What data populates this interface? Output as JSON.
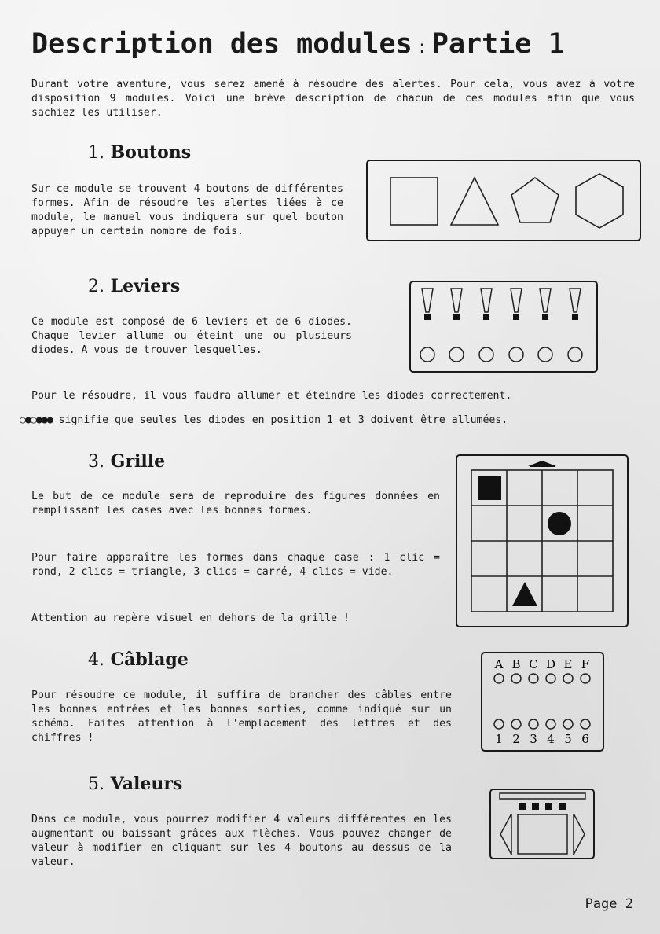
{
  "title": {
    "main": "Description des modules",
    "separator": ":",
    "part_word": "Partie",
    "part_number": "1"
  },
  "intro": "Durant votre aventure, vous serez amené à résoudre des alertes. Pour cela, vous avez à votre disposition 9 modules. Voici une brève description de chacun de ces modules afin que vous sachiez les utiliser.",
  "sections": {
    "boutons": {
      "number": "1.",
      "title": "Boutons",
      "text": "Sur ce module se trouvent 4 boutons de différentes formes. Afin de résoudre les alertes liées à ce module, le manuel vous indiquera sur quel bouton appuyer un certain nombre de fois."
    },
    "leviers": {
      "number": "2.",
      "title": "Leviers",
      "text": "Ce module est composé de 6 leviers et de 6 diodes. Chaque levier allume ou éteint une ou plusieurs diodes. A vous de trouver lesquelles.",
      "note": "Pour le résoudre, il vous faudra allumer et éteindre les diodes correctement.",
      "example_symbols": "○●○●●●",
      "example_text": "signifie que seules les diodes en position 1 et 3 doivent être allumées."
    },
    "grille": {
      "number": "3.",
      "title": "Grille",
      "text1": "Le but de ce module sera de reproduire des figures données en remplissant les cases avec les bonnes formes.",
      "text2": "Pour faire apparaître les formes dans chaque case : 1 clic = rond, 2 clics = triangle, 3 clics = carré, 4 clics = vide.",
      "text3": "Attention au repère visuel en dehors de la grille !"
    },
    "cablage": {
      "number": "4.",
      "title": "Câblage",
      "text": "Pour résoudre ce module, il suffira de brancher des câbles entre les bonnes entrées et les bonnes sorties, comme indiqué sur un schéma. Faites attention à l'emplacement des lettres et des chiffres !",
      "letters": [
        "A",
        "B",
        "C",
        "D",
        "E",
        "F"
      ],
      "numbers": [
        "1",
        "2",
        "3",
        "4",
        "5",
        "6"
      ]
    },
    "valeurs": {
      "number": "5.",
      "title": "Valeurs",
      "text": "Dans ce module, vous pourrez modifier 4 valeurs différentes en les augmentant ou baissant grâces aux flèches. Vous pouvez changer de valeur à modifier en cliquant sur les 4 boutons au dessus de la valeur."
    }
  },
  "footer": {
    "page": "Page 2"
  }
}
